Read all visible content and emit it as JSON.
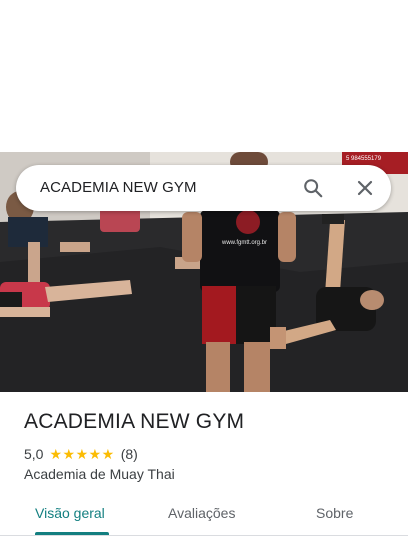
{
  "search": {
    "query": "ACADEMIA NEW GYM"
  },
  "photo": {
    "shirt_text": "www.fgmtt.org.br",
    "sign_text": "5 984555179"
  },
  "place": {
    "name": "ACADEMIA NEW GYM",
    "rating": "5,0",
    "stars": "★★★★★",
    "review_count": "(8)",
    "category": "Academia de Muay Thai"
  },
  "tabs": [
    {
      "label": "Visão geral"
    },
    {
      "label": "Avaliações"
    },
    {
      "label": "Sobre"
    }
  ],
  "colors": {
    "accent": "#137f80",
    "star": "#fbbc04"
  }
}
